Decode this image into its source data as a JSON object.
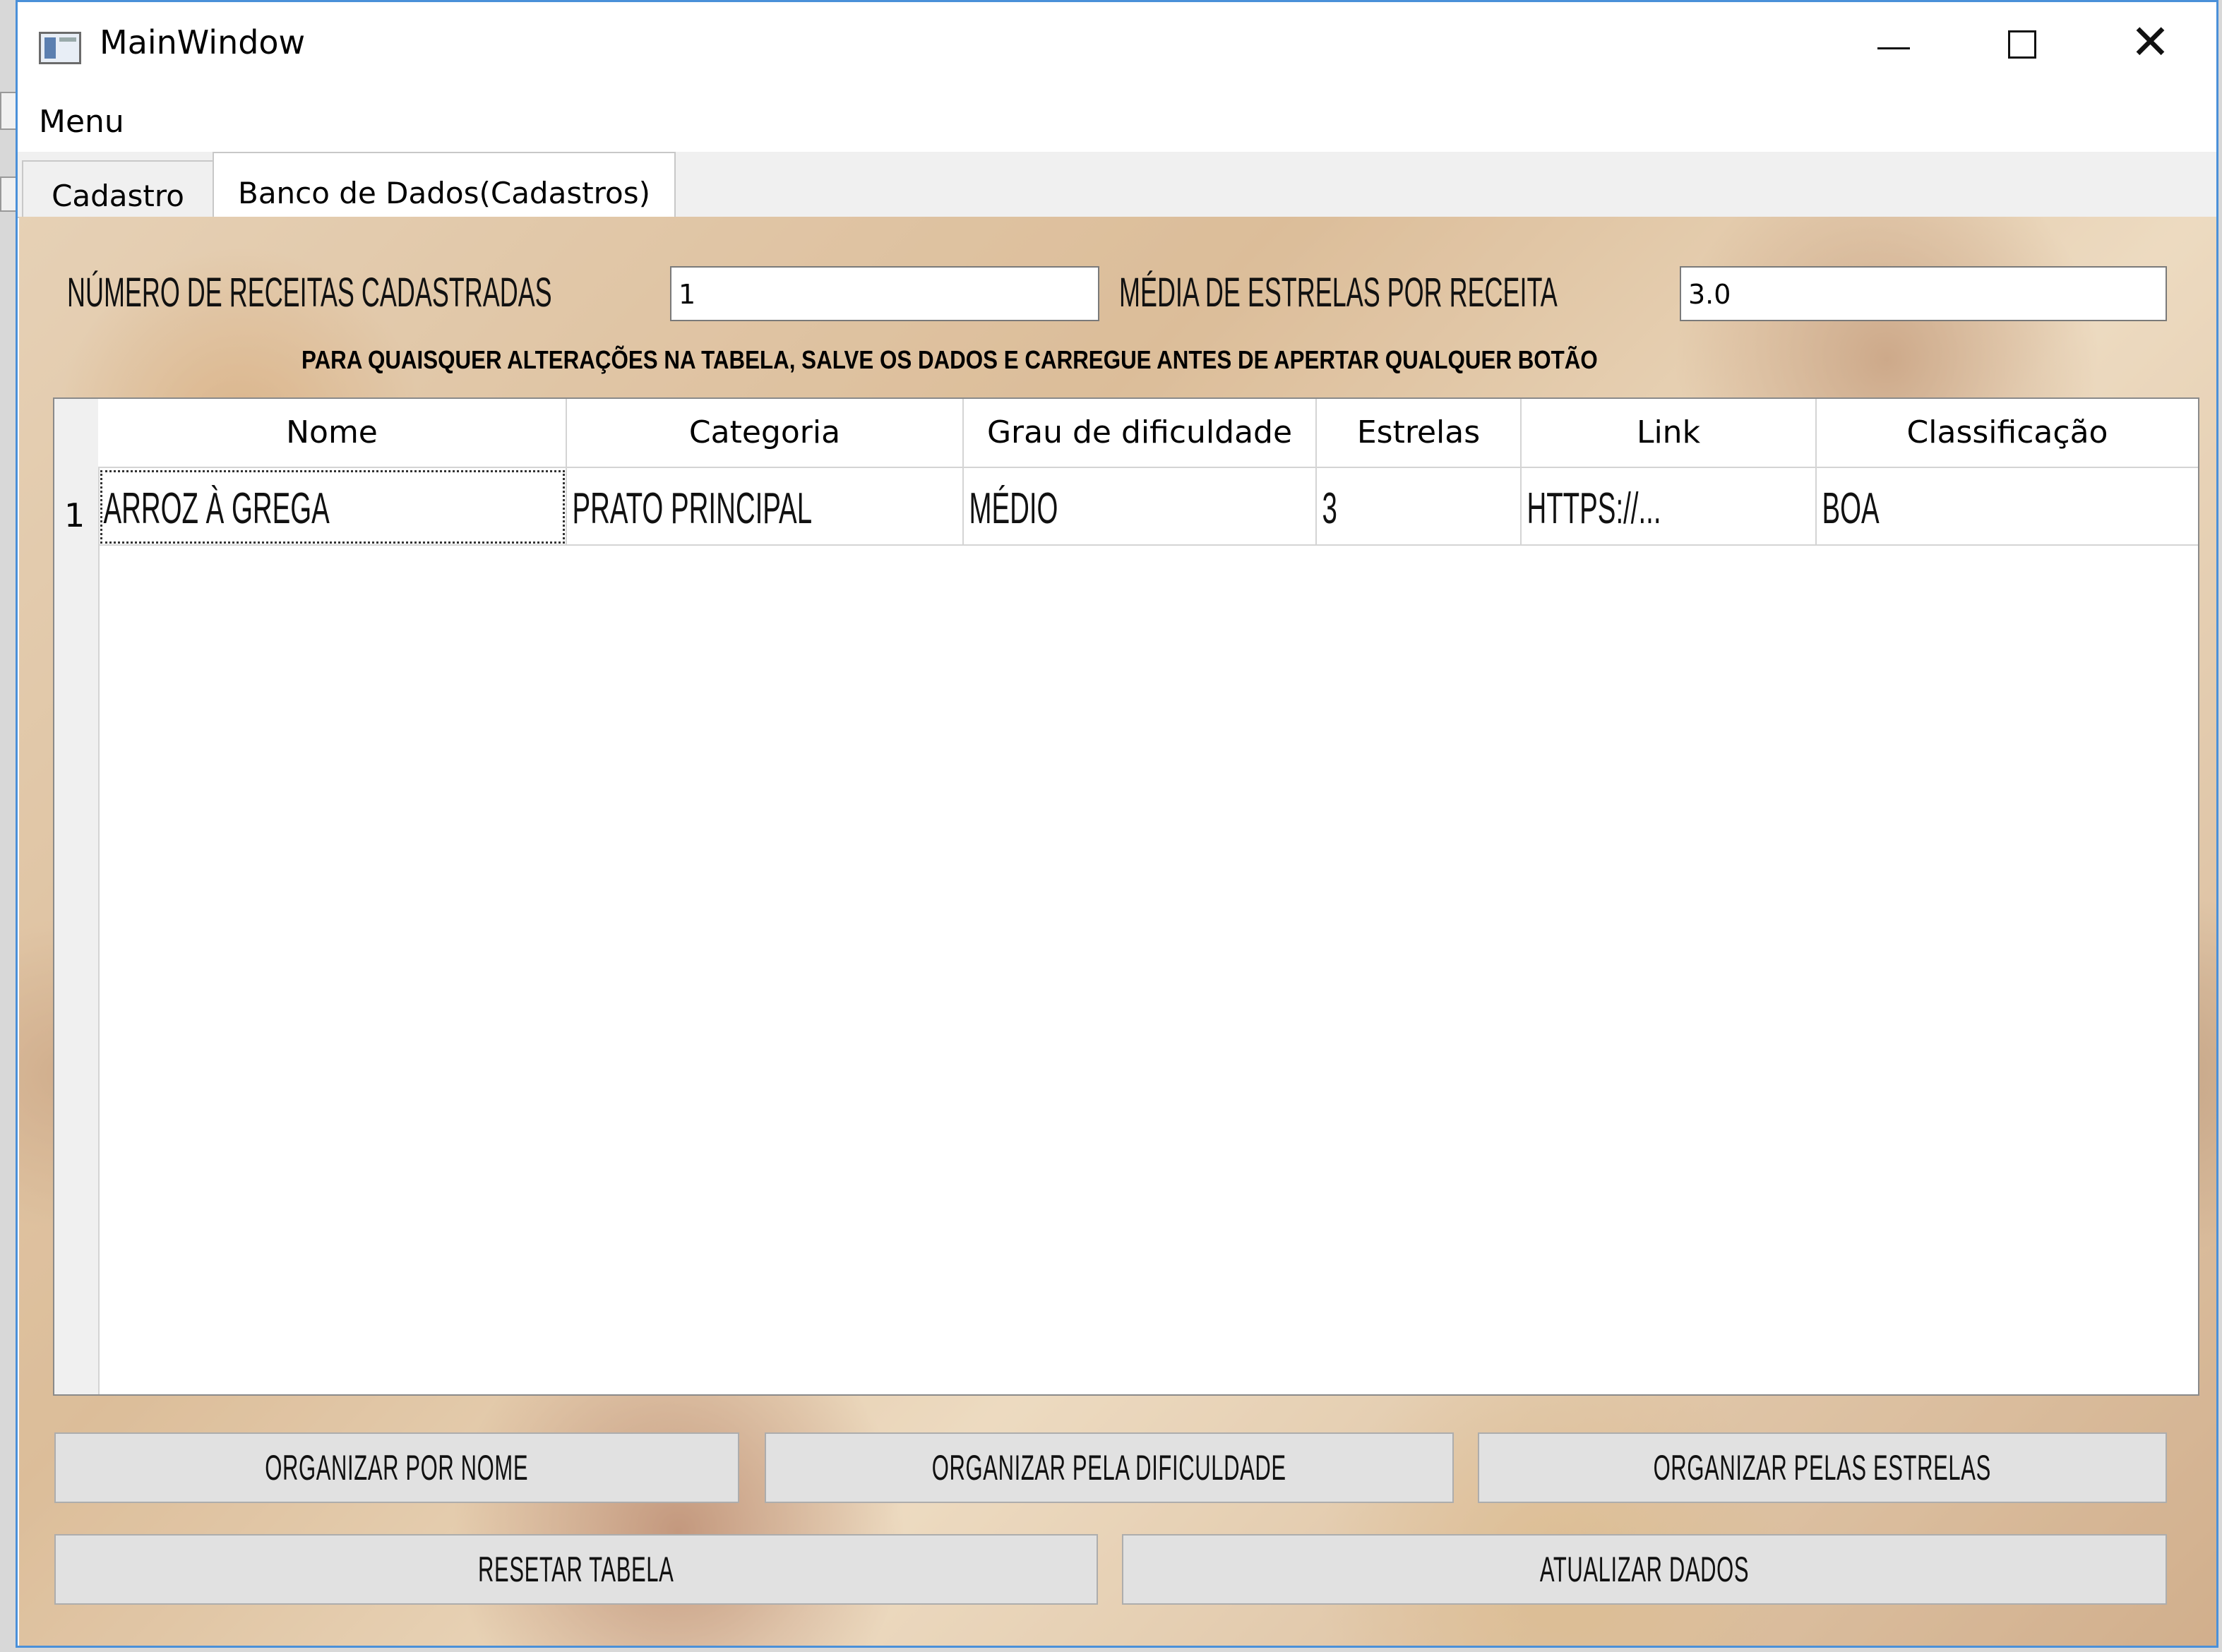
{
  "window": {
    "title": "MainWindow"
  },
  "menubar": {
    "menu_label": "Menu"
  },
  "tabs": [
    {
      "label": "Cadastro"
    },
    {
      "label": "Banco de Dados(Cadastros)"
    }
  ],
  "stats": {
    "count_label": "NÚMERO DE RECEITAS CADASTRADAS",
    "count_value": "1",
    "average_label": "MÉDIA DE ESTRELAS POR RECEITA",
    "average_value": "3.0"
  },
  "notice": "PARA QUAISQUER ALTERAÇÕES NA TABELA, SALVE OS DADOS E CARREGUE ANTES DE APERTAR QUALQUER BOTÃO",
  "table": {
    "columns": [
      "Nome",
      "Categoria",
      "Grau de dificuldade",
      "Estrelas",
      "Link",
      "Classificação"
    ],
    "rows": [
      {
        "number": "1",
        "cells": [
          "ARROZ À GREGA",
          "PRATO PRINCIPAL",
          "MÉDIO",
          "3",
          "HTTPS://...",
          "BOA"
        ]
      }
    ]
  },
  "buttons": {
    "sort_name": "ORGANIZAR POR NOME",
    "sort_difficulty": "ORGANIZAR PELA DIFICULDADE",
    "sort_stars": "ORGANIZAR PELAS ESTRELAS",
    "reset": "RESETAR TABELA",
    "update": "ATUALIZAR DADOS"
  }
}
